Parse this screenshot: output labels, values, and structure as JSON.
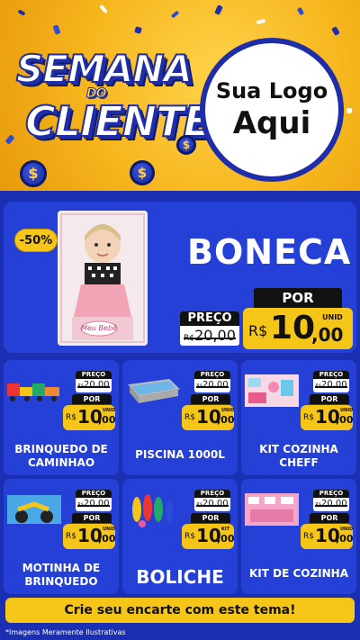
{
  "header": {
    "title_line1": "SEMANA",
    "title_line2": "DO",
    "title_line3": "CLIENTE",
    "logo_line1": "Sua Logo",
    "logo_line2": "Aqui"
  },
  "hero": {
    "discount": "-50%",
    "product_name": "BONECA",
    "old_label": "PREÇO",
    "old_currency": "R$",
    "old_price": "20,00",
    "new_label": "POR",
    "new_unit": "UNID",
    "new_currency": "R$",
    "new_int": "10",
    "new_dec": ",00",
    "box_text": "Meu Bebê"
  },
  "products": [
    {
      "name_line1": "BRINQUEDO DE",
      "name_line2": "CAMINHAO",
      "old_label": "PREÇO",
      "old_price": "20,00",
      "new_label": "POR",
      "unit": "UNID",
      "currency": "R$",
      "new_int": "10",
      "new_dec": ",00"
    },
    {
      "name_line1": "PISCINA 1000L",
      "name_line2": "",
      "old_label": "PREÇO",
      "old_price": "20,00",
      "new_label": "POR",
      "unit": "UNID",
      "currency": "R$",
      "new_int": "10",
      "new_dec": ",00"
    },
    {
      "name_line1": "KIT COZINHA",
      "name_line2": "CHEFF",
      "old_label": "PREÇO",
      "old_price": "20,00",
      "new_label": "POR",
      "unit": "UNID",
      "currency": "R$",
      "new_int": "10",
      "new_dec": ",00"
    },
    {
      "name_line1": "MOTINHA DE",
      "name_line2": "BRINQUEDO",
      "old_label": "PREÇO",
      "old_price": "20,00",
      "new_label": "POR",
      "unit": "UNID",
      "currency": "R$",
      "new_int": "10",
      "new_dec": ",00"
    },
    {
      "name_line1": "BOLICHE",
      "name_line2": "",
      "old_label": "PREÇO",
      "old_price": "20,00",
      "new_label": "POR",
      "unit": "KIT",
      "currency": "R$",
      "new_int": "10",
      "new_dec": ",00"
    },
    {
      "name_line1": "KIT DE COZINHA",
      "name_line2": "",
      "old_label": "PREÇO",
      "old_price": "20,00",
      "new_label": "POR",
      "unit": "UNID",
      "currency": "R$",
      "new_int": "10",
      "new_dec": ",00"
    }
  ],
  "footer": {
    "cta": "Crie seu encarte com este tema!",
    "disclaimer": "*Imagens Meramente Ilustrativas"
  },
  "colors": {
    "brand_blue": "#1b2fb2",
    "card_blue": "#2440d6",
    "accent_yellow": "#f5c518",
    "header_orange": "#f6b51c"
  }
}
